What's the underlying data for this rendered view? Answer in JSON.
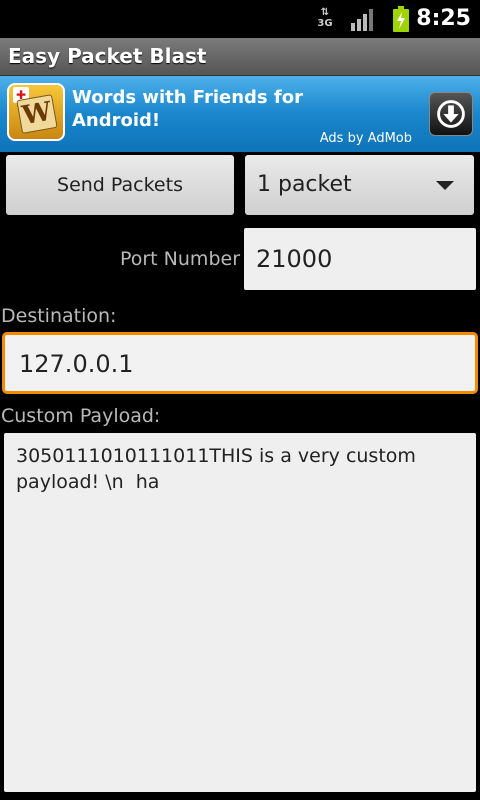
{
  "status_bar": {
    "network_label": "3G",
    "time": "8:25",
    "battery_color": "#9fd400"
  },
  "app": {
    "title": "Easy Packet Blast"
  },
  "ad": {
    "headline": "Words with Friends for Android!",
    "byline": "Ads by AdMob",
    "icon_letter": "W",
    "brand_color": "#1a86cc"
  },
  "form": {
    "send_button_label": "Send Packets",
    "packet_count_selected": "1 packet",
    "port_label": "Port Number",
    "port_value": "21000",
    "destination_label": "Destination:",
    "destination_value": "127.0.0.1",
    "payload_label": "Custom Payload:",
    "payload_value": "3050111010111011THIS is a very custom payload! \\n  ha",
    "focus_color": "#f28b00"
  }
}
